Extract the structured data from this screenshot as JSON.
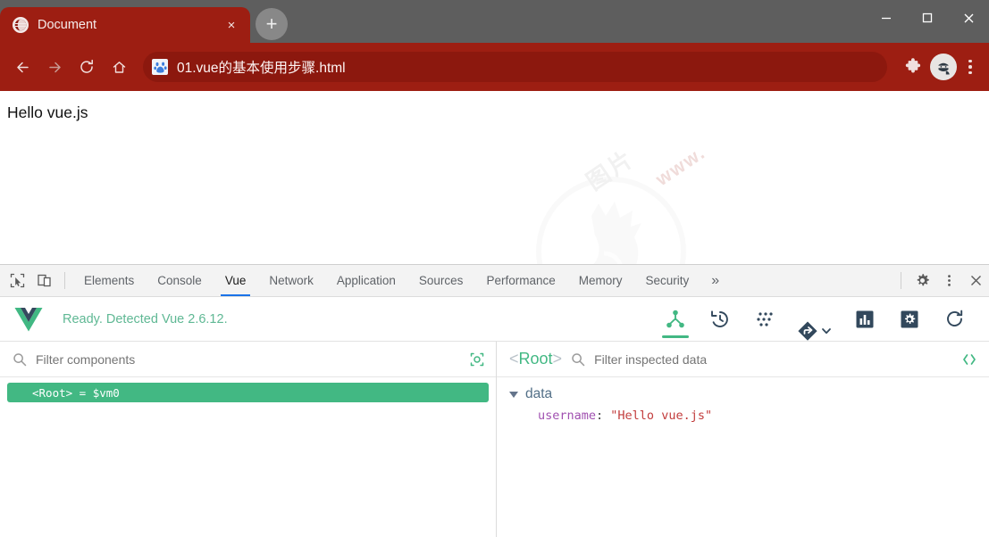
{
  "window": {
    "minimize_label": "—",
    "maximize_label": "□",
    "close_label": "×"
  },
  "tabs": [
    {
      "title": "Document",
      "favicon": "globe-icon",
      "close_label": "×"
    }
  ],
  "newtab_label": "+",
  "toolbar": {
    "back_label": "←",
    "forward_label": "→",
    "reload_label": "⟳",
    "home_label": "⌂",
    "url": "01.vue的基本使用步骤.html",
    "url_favicon": "baidu-icon",
    "extensions_label": "puzzle-icon",
    "profile_label": "incognito-avatar",
    "menu_label": "kebab-menu"
  },
  "page": {
    "text": "Hello vue.js",
    "watermark_text": "www.",
    "watermark_cn": "图片"
  },
  "devtools": {
    "inspect_icon": "inspect-element-icon",
    "device_icon": "device-toolbar-icon",
    "tabs": [
      {
        "label": "Elements",
        "active": false
      },
      {
        "label": "Console",
        "active": false
      },
      {
        "label": "Vue",
        "active": true
      },
      {
        "label": "Network",
        "active": false
      },
      {
        "label": "Application",
        "active": false
      },
      {
        "label": "Sources",
        "active": false
      },
      {
        "label": "Performance",
        "active": false
      },
      {
        "label": "Memory",
        "active": false
      },
      {
        "label": "Security",
        "active": false
      }
    ],
    "overflow_label": "»",
    "settings_label": "gear-icon",
    "more_label": "kebab-icon",
    "close_label": "×"
  },
  "vue": {
    "status": "Ready. Detected Vue 2.6.12.",
    "logo": "vue-logo",
    "tools": [
      {
        "name": "components-tab",
        "icon": "component-tree-icon",
        "active": true
      },
      {
        "name": "timeline-tab",
        "icon": "history-clock-icon",
        "active": false
      },
      {
        "name": "vuex-tab",
        "icon": "vuex-dots-icon",
        "active": false
      },
      {
        "name": "routing-tab",
        "icon": "router-diamond-icon",
        "active": false
      },
      {
        "name": "performance-tab",
        "icon": "bar-chart-icon",
        "active": false
      },
      {
        "name": "settings-tab",
        "icon": "gear-square-icon",
        "active": false
      },
      {
        "name": "refresh-button",
        "icon": "refresh-icon",
        "active": false
      }
    ],
    "tree_panel": {
      "filter_placeholder": "Filter components",
      "filter_value": "",
      "select_icon": "target-crosshair-icon",
      "items": [
        {
          "label": "<Root> = $vm0",
          "selected": true
        }
      ]
    },
    "inspect_panel": {
      "component_bracket_open": "<",
      "component_name": "Root",
      "component_bracket_close": ">",
      "filter_placeholder": "Filter inspected data",
      "filter_value": "",
      "code_icon": "angle-brackets-icon",
      "groups": [
        {
          "name": "data",
          "expanded": true,
          "props": [
            {
              "key": "username",
              "separator": ": ",
              "value": "\"Hello vue.js\"",
              "type": "string"
            }
          ]
        }
      ]
    }
  },
  "colors": {
    "chrome_red": "#9d1e12",
    "omnibox_red": "#8c180e",
    "titlebar_gray": "#5e5e5e",
    "vue_green": "#42b883",
    "vue_status_green": "#5fb894",
    "devtools_blue": "#1a73e8",
    "prop_key_purple": "#a050b0",
    "prop_string_red": "#c23c3c"
  }
}
